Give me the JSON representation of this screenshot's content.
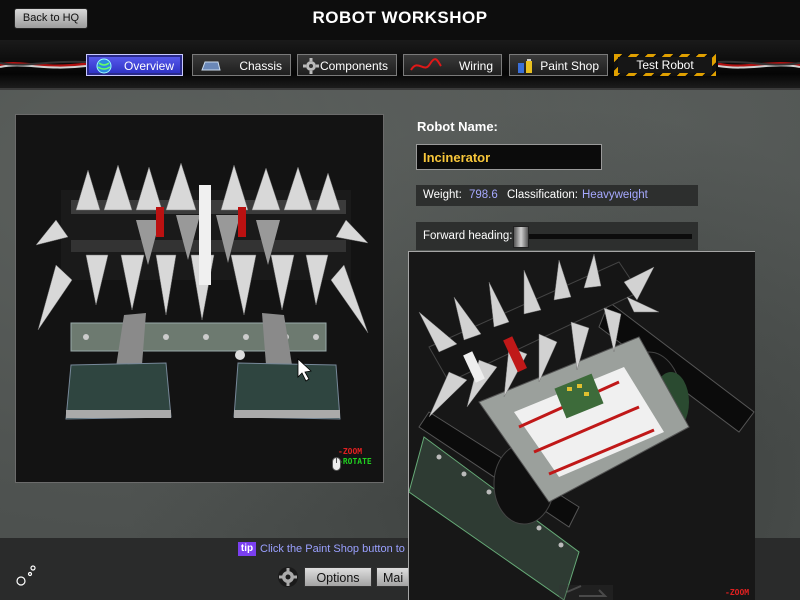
{
  "header": {
    "title": "ROBOT WORKSHOP",
    "back_label": "Back to HQ"
  },
  "tabs": [
    {
      "label": "Overview",
      "icon": "globe-icon",
      "active": true
    },
    {
      "label": "Chassis",
      "icon": "chassis-icon",
      "active": false
    },
    {
      "label": "Components",
      "icon": "gear-icon",
      "active": false
    },
    {
      "label": "Wiring",
      "icon": "wire-icon",
      "active": false
    },
    {
      "label": "Paint Shop",
      "icon": "paint-can-icon",
      "active": false
    },
    {
      "label": "Test Robot",
      "icon": "hazard-stripe",
      "active": false
    }
  ],
  "robot": {
    "name_label": "Robot Name:",
    "name_value": "Incinerator",
    "weight_label": "Weight:",
    "weight_value": "798.6",
    "class_label": "Classification:",
    "class_value": "Heavyweight",
    "heading_label": "Forward heading:"
  },
  "viewport_hint": {
    "zoom": "-ZOOM",
    "rotate": "-ROTATE"
  },
  "popup_hint": {
    "zoom": "-ZOOM"
  },
  "footer": {
    "tip_badge": "tip",
    "tip_text": "Click the Paint Shop button to cu",
    "options_label": "Options",
    "main_label": "Mai"
  },
  "colors": {
    "accent_blue": "#3a3dd8",
    "robot_name_color": "#f7c63a",
    "stat_value_color": "#a6a9ff",
    "tip_purple": "#7b3ff0",
    "hazard_yellow": "#e0a000"
  }
}
